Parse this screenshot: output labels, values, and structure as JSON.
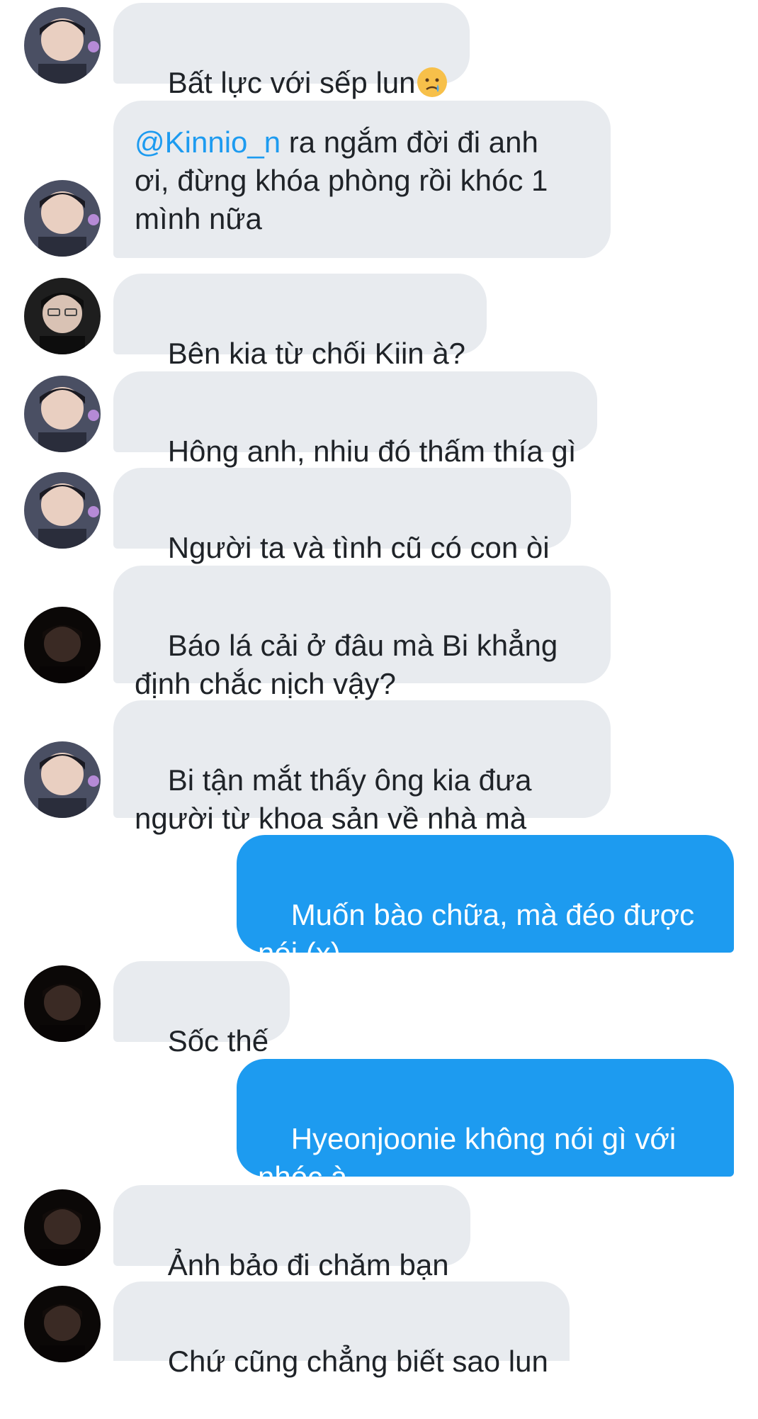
{
  "conversation": {
    "messages": [
      {
        "direction": "in",
        "avatar": "avatar-a",
        "text": "Bất lực với sếp lun",
        "emoji": "crying-face-emoji"
      },
      {
        "direction": "in",
        "avatar": "avatar-a",
        "mention": "@Kinnio_n",
        "text": " ra ngắm đời đi anh\nơi, đừng khóa phòng rồi khóc 1\nmình nữa"
      },
      {
        "direction": "in",
        "avatar": "avatar-b",
        "text": "Bên kia từ chối Kiin à?"
      },
      {
        "direction": "in",
        "avatar": "avatar-a",
        "text": "Hông anh, nhiu đó thấm thía gì"
      },
      {
        "direction": "in",
        "avatar": "avatar-a",
        "text": "Người ta và tình cũ có con òi"
      },
      {
        "direction": "in",
        "avatar": "avatar-c",
        "text": "Báo lá cải ở đâu mà Bi khẳng\nđịnh chắc nịch vậy?"
      },
      {
        "direction": "in",
        "avatar": "avatar-a",
        "text": "Bi tận mắt thấy ông kia đưa\nngười từ khoa sản về nhà mà"
      },
      {
        "direction": "out",
        "text": "Muốn bào chữa, mà đéo được\nnói (x)"
      },
      {
        "direction": "in",
        "avatar": "avatar-c",
        "text": "Sốc thế"
      },
      {
        "direction": "out",
        "text": "Hyeonjoonie không nói gì với\nnhóc à"
      },
      {
        "direction": "in",
        "avatar": "avatar-c",
        "text": "Ảnh bảo đi chăm bạn"
      },
      {
        "direction": "in",
        "avatar": "avatar-c",
        "text": "Chứ cũng chẳng biết sao lun"
      }
    ]
  },
  "colors": {
    "incoming_bubble": "#e8ebef",
    "outgoing_bubble": "#1d9bf0",
    "mention": "#1d9bf0",
    "text": "#1f2328"
  }
}
